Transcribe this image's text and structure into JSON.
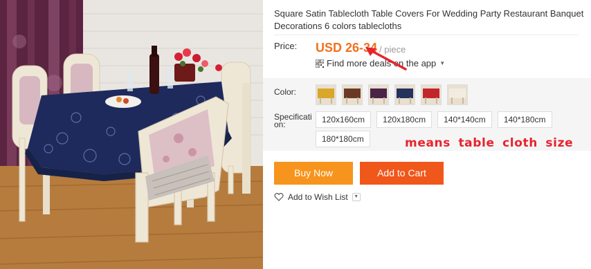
{
  "product": {
    "title": "Square Satin Tablecloth Table Covers For Wedding Party Restaurant Banquet Decorations 6 colors tablecloths",
    "image_alt_icon": "dining-table-photo"
  },
  "price": {
    "label": "Price:",
    "value": "USD 26-34",
    "unit": "/ piece",
    "deals_text": "Find more deals on the app",
    "accent_color": "#f2701e"
  },
  "color": {
    "label": "Color:",
    "swatches": [
      {
        "cloth": "#d9a72a"
      },
      {
        "cloth": "#6b3a26"
      },
      {
        "cloth": "#4a2346"
      },
      {
        "cloth": "#24325c"
      },
      {
        "cloth": "#c2262a"
      },
      {
        "cloth": "#f2ece0"
      }
    ]
  },
  "specification": {
    "label": "Specification:",
    "options": [
      "120x160cm",
      "120x180cm",
      "140*140cm",
      "140*180cm",
      "180*180cm"
    ]
  },
  "annotation": {
    "text": "means table cloth size",
    "color": "#e8232c"
  },
  "actions": {
    "buy_now": "Buy Now",
    "add_to_cart": "Add to Cart",
    "wish_list": "Add to Wish List"
  }
}
